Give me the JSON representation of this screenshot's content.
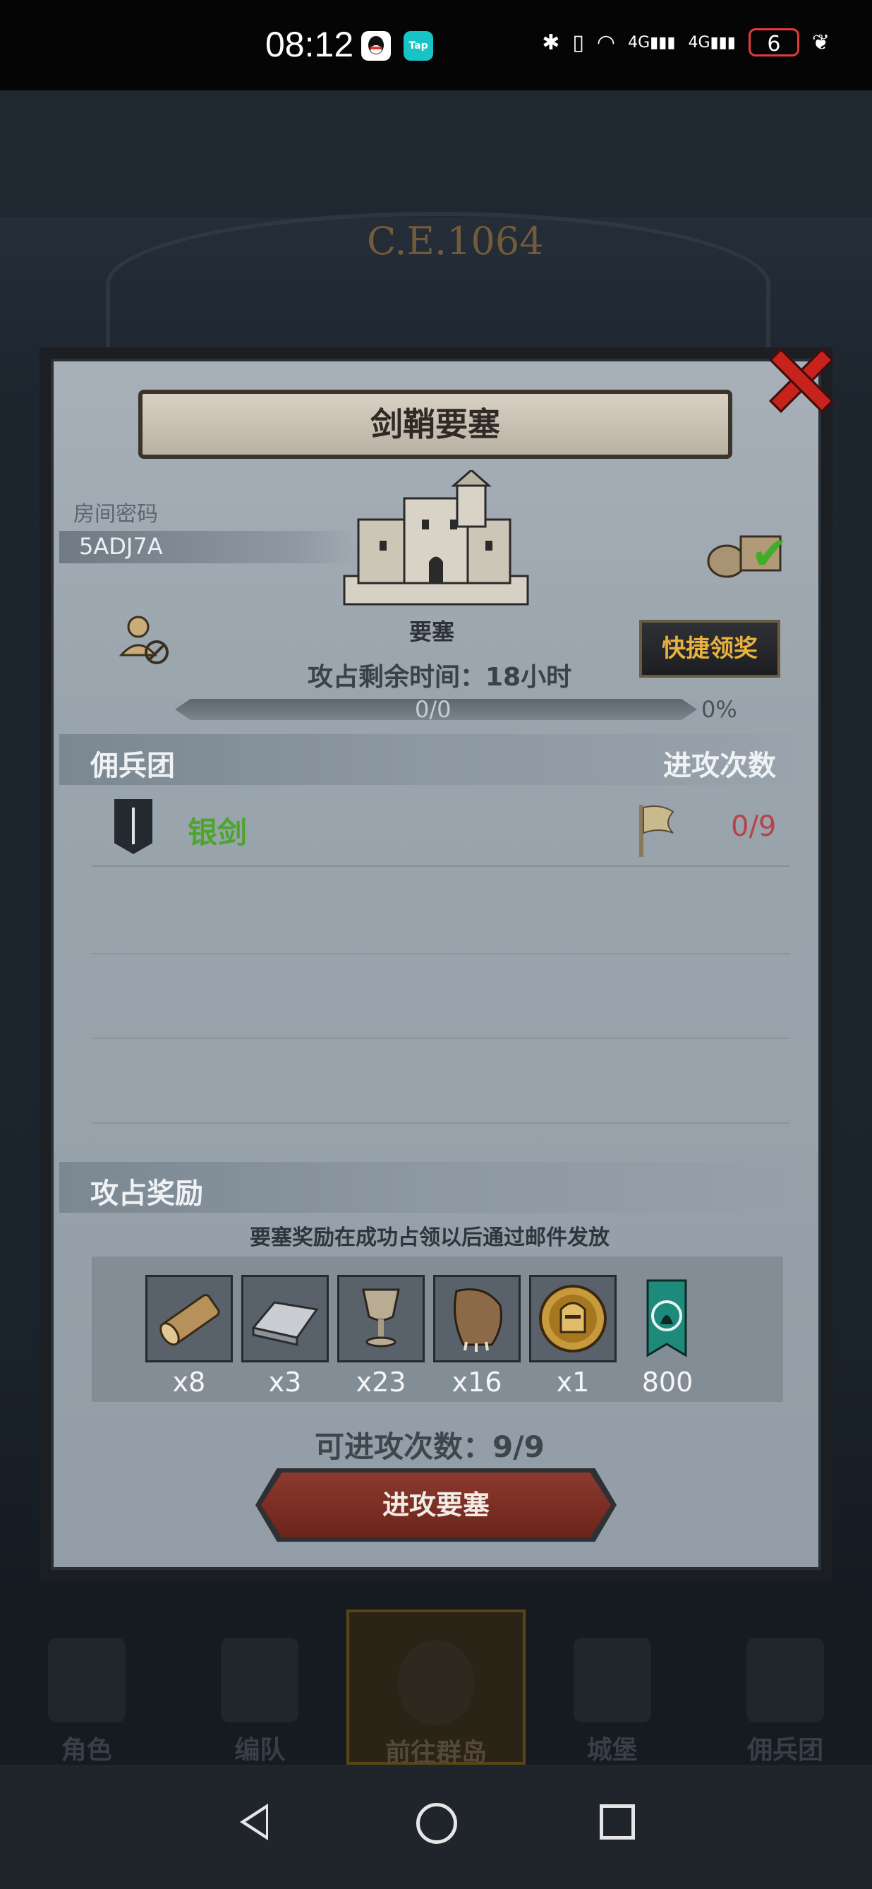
{
  "status_bar": {
    "time": "08:12",
    "signal_1": "4G",
    "signal_2": "4G",
    "battery": "6",
    "app_icon_2": "Tap"
  },
  "background": {
    "year": "C.E.1064"
  },
  "dialog": {
    "title": "剑鞘要塞",
    "room_label": "房间密码",
    "room_code": "5ADJ7A",
    "fortress_label": "要塞",
    "quick_claim": "快捷领奖",
    "remaining_time": "攻占剩余时间：18小时",
    "progress": {
      "text": "0/0",
      "percent": "0%",
      "fraction": 0
    },
    "mercenary_section": "佣兵团",
    "attack_count_header": "进攻次数",
    "mercenaries": [
      {
        "name": "银剑",
        "attacks": "0/9"
      }
    ],
    "reward_section": "攻占奖励",
    "reward_note": "要塞奖励在成功占领以后通过邮件发放",
    "rewards": [
      {
        "icon": "wood-log-icon",
        "qty": "x8"
      },
      {
        "icon": "iron-ingot-icon",
        "qty": "x3"
      },
      {
        "icon": "goblet-icon",
        "qty": "x23"
      },
      {
        "icon": "fur-pelt-icon",
        "qty": "x16"
      },
      {
        "icon": "knight-medal-icon",
        "qty": "x1"
      },
      {
        "icon": "guild-banner-icon",
        "qty": "800"
      }
    ],
    "available_attacks": "可进攻次数：9/9",
    "attack_button": "进攻要塞"
  },
  "game_nav": [
    {
      "label": "角色",
      "icon": "character-icon"
    },
    {
      "label": "编队",
      "icon": "formation-icon"
    },
    {
      "label": "前往群岛",
      "icon": "islands-icon"
    },
    {
      "label": "城堡",
      "icon": "castle-icon"
    },
    {
      "label": "佣兵团",
      "icon": "mercenary-icon"
    }
  ],
  "colors": {
    "accent_gold": "#e9b23e",
    "merc_green": "#4ea52e",
    "count_red": "#b84247",
    "close_red": "#c7221c"
  }
}
